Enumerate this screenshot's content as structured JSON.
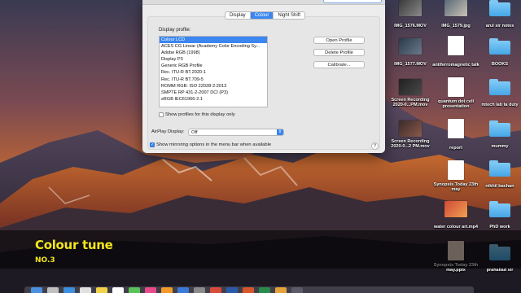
{
  "window": {
    "tabs": [
      {
        "label": "Display",
        "active": false
      },
      {
        "label": "Colour",
        "active": true
      },
      {
        "label": "Night Shift",
        "active": false
      }
    ],
    "display_profile_label": "Display profile:",
    "profiles": [
      "Colour LCD",
      "ACES CG Linear (Academy Color Encoding Sy...",
      "Adobe RGB (1998)",
      "Display P3",
      "Generic RGB Profile",
      "Rec. ITU-R BT.2020-1",
      "Rec. ITU-R BT.709-5",
      "ROMM RGB: ISO 22028-2:2013",
      "SMPTE RP 431-2-2007 DCI (P3)",
      "sRGB IEC61966-2.1"
    ],
    "selected_profile": "Colour LCD",
    "buttons": {
      "open_profile": "Open Profile",
      "delete_profile": "Delete Profile",
      "calibrate": "Calibrate..."
    },
    "show_profiles_only": {
      "label": "Show profiles for this display only",
      "checked": false
    },
    "airplay": {
      "label": "AirPlay Display:",
      "value": "Off"
    },
    "mirroring": {
      "label": "Show mirroring options in the menu bar when available",
      "checked": true
    },
    "help": "?"
  },
  "desktop": {
    "icons": [
      {
        "name": "IMG_1576.MOV",
        "kind": "video"
      },
      {
        "name": "IMG_1579.jpg",
        "kind": "image"
      },
      {
        "name": "arul sir notes",
        "kind": "folder"
      },
      {
        "name": "IMG_1577.MOV",
        "kind": "video"
      },
      {
        "name": "antiferromagnetic talk",
        "kind": "doc"
      },
      {
        "name": "BOOKS",
        "kind": "folder"
      },
      {
        "name": "Screen Recording 2020-0...PM.mov",
        "kind": "video"
      },
      {
        "name": "quantum dot cell presentation",
        "kind": "doc"
      },
      {
        "name": "mtech lab ta duty",
        "kind": "folder"
      },
      {
        "name": "Screen Recording 2020-0...2 PM.mov",
        "kind": "video"
      },
      {
        "name": "report",
        "kind": "doc"
      },
      {
        "name": "mummy",
        "kind": "folder"
      },
      {
        "name": "Synopsis Today 23th may",
        "kind": "doc"
      },
      {
        "name": "nikhil bachan",
        "kind": "folder"
      },
      {
        "name": "water colour art.mp4",
        "kind": "video"
      },
      {
        "name": "PhD work",
        "kind": "folder"
      },
      {
        "name": "Synopsis Today 23th may.pptx",
        "kind": "doc"
      },
      {
        "name": "prahallad sir",
        "kind": "folder"
      }
    ]
  },
  "caption": {
    "title": "Colour tune",
    "subtitle": "NO.3"
  },
  "colors": {
    "accent": "#3b86f1",
    "caption_text": "#f4e51c",
    "folder": "#5bb5ee"
  }
}
